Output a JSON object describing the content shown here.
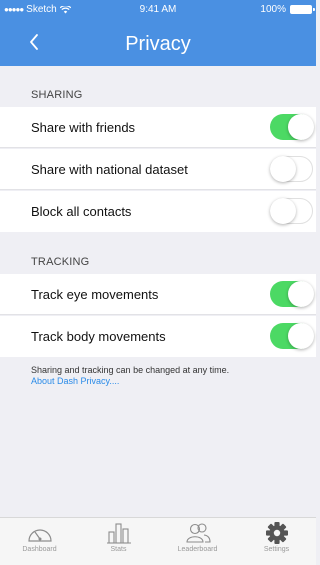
{
  "status_bar": {
    "carrier": "Sketch",
    "time": "9:41 AM",
    "battery": "100%"
  },
  "nav": {
    "title": "Privacy",
    "back_icon": "chevron-left-icon"
  },
  "colors": {
    "accent": "#4a90e2",
    "toggle_on": "#4cd964",
    "link": "#2a8be8"
  },
  "sharing": {
    "header": "SHARING",
    "rows": [
      {
        "label": "Share with friends",
        "on": true
      },
      {
        "label": "Share with national dataset",
        "on": false
      },
      {
        "label": "Block all contacts",
        "on": false
      }
    ]
  },
  "tracking": {
    "header": "TRACKING",
    "rows": [
      {
        "label": "Track eye movements",
        "on": true
      },
      {
        "label": "Track body movements",
        "on": true
      }
    ]
  },
  "footer": {
    "note": "Sharing and tracking can be changed at any time.",
    "link": "About Dash Privacy...."
  },
  "tabs": [
    {
      "label": "Dashboard",
      "icon": "gauge-icon"
    },
    {
      "label": "Stats",
      "icon": "bar-chart-icon"
    },
    {
      "label": "Leaderboard",
      "icon": "users-icon"
    },
    {
      "label": "Settings",
      "icon": "gear-icon"
    }
  ]
}
